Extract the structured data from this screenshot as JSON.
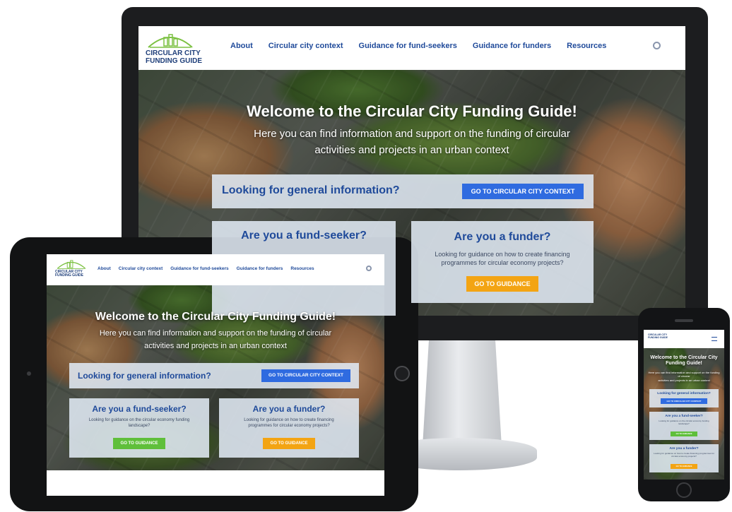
{
  "site": {
    "logo_line1": "CIRCULAR CITY",
    "logo_line2": "FUNDING GUIDE",
    "nav": [
      "About",
      "Circular city context",
      "Guidance for fund-seekers",
      "Guidance for funders",
      "Resources"
    ],
    "search_icon": "search-icon",
    "hero_title": "Welcome to the Circular City Funding Guide!",
    "hero_subtitle_line1": "Here you can find information and support on the funding of circular",
    "hero_subtitle_line2": "activities and projects in an urban context",
    "general_info_title": "Looking for general information?",
    "general_info_button": "GO TO CIRCULAR CITY CONTEXT",
    "fund_seeker_title": "Are you a fund-seeker?",
    "fund_seeker_text": "Looking for guidance on the circular economy funding landscape?",
    "fund_seeker_button": "GO TO GUIDANCE",
    "funder_title": "Are you a funder?",
    "funder_text": "Looking for guidance on how to create financing programmes for circular economy projects?",
    "funder_button": "GO TO GUIDANCE"
  },
  "colors": {
    "brand_blue": "#1f4a9a",
    "button_blue": "#2f6be0",
    "button_orange": "#f3a413",
    "button_green": "#5fbf3a"
  }
}
